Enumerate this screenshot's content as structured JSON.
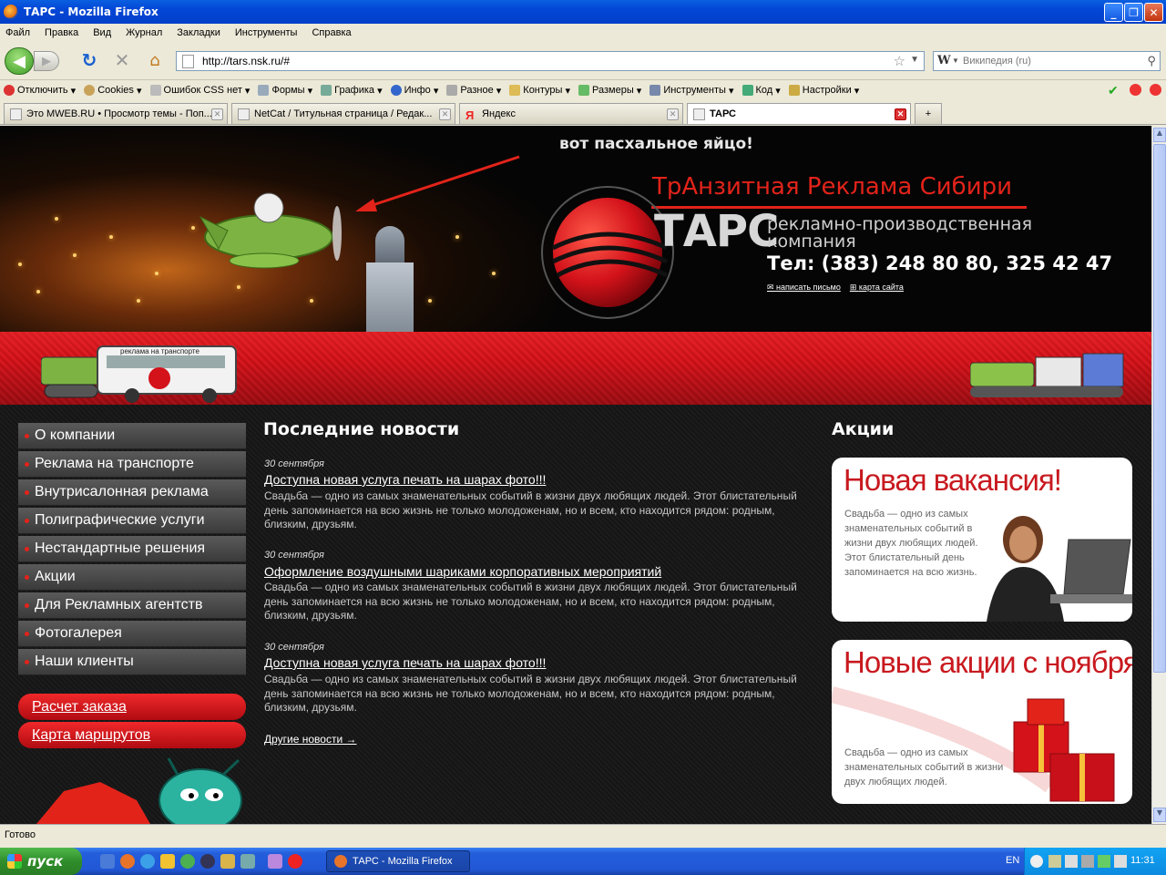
{
  "window": {
    "title": "ТАРС - Mozilla Firefox"
  },
  "menubar": [
    "Файл",
    "Правка",
    "Вид",
    "Журнал",
    "Закладки",
    "Инструменты",
    "Справка"
  ],
  "nav": {
    "url": "http://tars.nsk.ru/#",
    "search_placeholder": "Википедия (ru)",
    "search_engine": "W"
  },
  "devtoolbar": [
    "Отключить",
    "Cookies",
    "Ошибок CSS нет",
    "Формы",
    "Графика",
    "Инфо",
    "Разное",
    "Контуры",
    "Размеры",
    "Инструменты",
    "Код",
    "Настройки"
  ],
  "tabs": [
    {
      "label": "Это MWEB.RU • Просмотр темы - Поп..."
    },
    {
      "label": "NetCat / Титульная страница / Редак..."
    },
    {
      "label": "Яндекс"
    },
    {
      "label": "ТАРС"
    }
  ],
  "header": {
    "easter_egg": "вот пасхальное яйцо!",
    "tagline": "ТрАнзитная Реклама Сибири",
    "logo_word": "ТАРС",
    "company_type_1": "рекламно-производственная",
    "company_type_2": "компания",
    "phone": "Тел: (383) 248 80 80, 325 42 47",
    "link_mail": "написать письмо",
    "link_map": "карта сайта",
    "bus_label": "реклама на транспорте"
  },
  "sidemenu": [
    "О компании",
    "Реклама на транспорте",
    "Внутрисалонная реклама",
    "Полиграфические услуги",
    "Нестандартные решения",
    "Акции",
    "Для Рекламных агентств",
    "Фотогалерея",
    "Наши клиенты"
  ],
  "redbuttons": [
    "Расчет заказа",
    "Карта маршрутов"
  ],
  "news": {
    "title": "Последние новости",
    "items": [
      {
        "date": "30 сентября",
        "headline": "Доступна новая услуга печать на шарах фото!!!",
        "body": "Свадьба — одно из самых знаменательных событий в жизни двух любящих людей. Этот блистательный день запоминается на всю жизнь не только молодоженам, но и всем, кто находится рядом: родным, близким, друзьям."
      },
      {
        "date": "30 сентября",
        "headline": "Оформление воздушными шариками корпоративных мероприятий",
        "body": "Свадьба — одно из самых знаменательных событий в жизни двух любящих людей. Этот блистательный день запоминается на всю жизнь не только молодоженам, но и всем, кто находится рядом: родным, близким, друзьям."
      },
      {
        "date": "30 сентября",
        "headline": "Доступна новая услуга печать на шарах фото!!!",
        "body": "Свадьба — одно из самых знаменательных событий в жизни двух любящих людей. Этот блистательный день запоминается на всю жизнь не только молодоженам, но и всем, кто находится рядом: родным, близким, друзьям."
      }
    ],
    "more": "Другие новости →"
  },
  "promos": {
    "title": "Акции",
    "items": [
      {
        "title": "Новая вакансия!",
        "text": "Свадьба — одно из самых знаменательных событий в жизни двух любящих людей. Этот блистательный день запоминается на всю жизнь."
      },
      {
        "title": "Новые акции с ноября!",
        "text": "Свадьба — одно из самых знаменательных событий в жизни двух любящих людей."
      }
    ]
  },
  "status": "Готово",
  "taskbar": {
    "start": "пуск",
    "task": "ТАРС - Mozilla Firefox",
    "lang": "EN",
    "clock": "11:31"
  },
  "colors": {
    "brand_red": "#e2231a",
    "xp_blue": "#245edb"
  }
}
